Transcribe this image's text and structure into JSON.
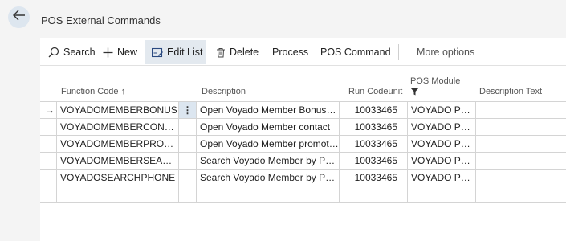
{
  "page": {
    "title": "POS External Commands"
  },
  "toolbar": {
    "search": "Search",
    "new": "New",
    "edit_list": "Edit List",
    "delete": "Delete",
    "process": "Process",
    "pos_command": "POS Command",
    "more_options": "More options"
  },
  "columns": {
    "function_code": "Function Code",
    "sort_indicator": "↑",
    "description": "Description",
    "run_codeunit": "Run Codeunit",
    "pos_module": "POS Module",
    "description_text": "Description Text"
  },
  "rows": [
    {
      "code": "VOYADOMEMBERBONUS",
      "description": "Open Voyado Member BonusCh...",
      "run_codeunit": "10033465",
      "module": "VOYADO POS ...",
      "description_text": "",
      "selected": true
    },
    {
      "code": "VOYADOMEMBERCONTACT",
      "description": "Open Voyado Member contact",
      "run_codeunit": "10033465",
      "module": "VOYADO POS ...",
      "description_text": ""
    },
    {
      "code": "VOYADOMEMBERPROMOS",
      "description": "Open Voyado Member promoti...",
      "run_codeunit": "10033465",
      "module": "VOYADO POS ...",
      "description_text": ""
    },
    {
      "code": "VOYADOMEMBERSEARCH",
      "description": "Search Voyado Member by Pho...",
      "run_codeunit": "10033465",
      "module": "VOYADO POS ...",
      "description_text": ""
    },
    {
      "code": "VOYADOSEARCHPHONE",
      "description": "Search Voyado Member by Pho...",
      "run_codeunit": "10033465",
      "module": "VOYADO POS ...",
      "description_text": ""
    }
  ],
  "row_marker": "→",
  "row_menu": "⋮",
  "colors": {
    "accent": "#dce6f0",
    "back_button": "#dde6ef",
    "active_tool": "#e3e9ef"
  }
}
